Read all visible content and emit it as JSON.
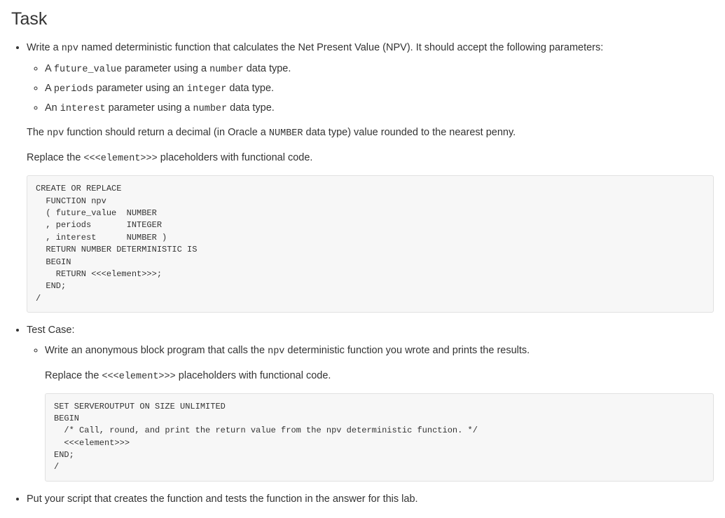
{
  "heading": "Task",
  "bullet1": {
    "prefix": "Write a ",
    "code1": "npv",
    "mid": " named deterministic function that calculates the Net Present Value (NPV). It should accept the following parameters:",
    "sub": [
      {
        "p1": "A ",
        "c1": "future_value",
        "p2": " parameter using a ",
        "c2": "number",
        "p3": " data type."
      },
      {
        "p1": "A ",
        "c1": "periods",
        "p2": " parameter using an ",
        "c2": "integer",
        "p3": " data type."
      },
      {
        "p1": "An ",
        "c1": "interest",
        "p2": " parameter using a ",
        "c2": "number",
        "p3": " data type."
      }
    ],
    "para1": {
      "p1": "The ",
      "c1": "npv",
      "p2": " function should return a decimal (in Oracle a ",
      "c2": "NUMBER",
      "p3": " data type) value rounded to the nearest penny."
    },
    "para2": {
      "p1": "Replace the ",
      "c1": "<<<element>>>",
      "p2": " placeholders with functional code."
    },
    "code_block": "CREATE OR REPLACE\n  FUNCTION npv\n  ( future_value  NUMBER\n  , periods       INTEGER\n  , interest      NUMBER )\n  RETURN NUMBER DETERMINISTIC IS\n  BEGIN\n    RETURN <<<element>>>;\n  END;\n/"
  },
  "bullet2": {
    "label": "Test Case:",
    "sub1": {
      "p1": "Write an anonymous block program that calls the ",
      "c1": "npv",
      "p2": " deterministic function you wrote and prints the results."
    },
    "para1": {
      "p1": "Replace the ",
      "c1": "<<<element>>>",
      "p2": " placeholders with functional code."
    },
    "code_block": "SET SERVEROUTPUT ON SIZE UNLIMITED\nBEGIN\n  /* Call, round, and print the return value from the npv deterministic function. */\n  <<<element>>>\nEND;\n/"
  },
  "bullet3": {
    "text": "Put your script that creates the function and tests the function in the answer for this lab."
  }
}
